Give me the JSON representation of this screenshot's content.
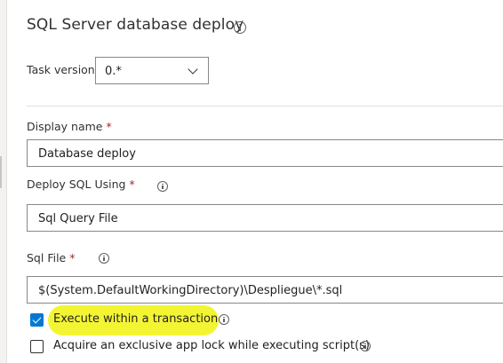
{
  "title": "SQL Server database deploy",
  "task_version": {
    "label": "Task version",
    "value": "0.*"
  },
  "display_name": {
    "label": "Display name",
    "required": "*",
    "value": "Database deploy"
  },
  "deploy_sql_using": {
    "label": "Deploy SQL Using",
    "required": "*",
    "value": "Sql Query File"
  },
  "sql_file": {
    "label": "Sql File",
    "required": "*",
    "value": "$(System.DefaultWorkingDirectory)\\Despliegue\\*.sql"
  },
  "options": [
    {
      "label": "Execute within a transaction",
      "checked": true
    },
    {
      "label": "Acquire an exclusive app lock while executing script(s)",
      "checked": false
    }
  ],
  "colors": {
    "accent": "#0078d4",
    "highlight": "#f3f533",
    "required": "#a4262c"
  }
}
